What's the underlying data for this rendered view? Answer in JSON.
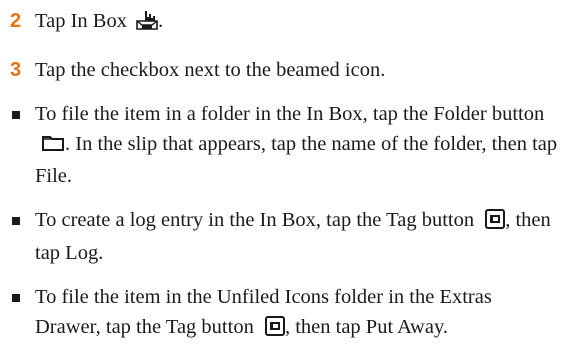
{
  "steps": [
    {
      "number": "2",
      "text_before_icon": "Tap In Box",
      "icon": "in-box-icon",
      "text_after_icon": "."
    },
    {
      "number": "3",
      "text": "Tap the checkbox next to the beamed icon."
    }
  ],
  "bullets": [
    {
      "text_before_icon": "To file the item in a folder in the In Box, tap the Folder button",
      "icon": "folder-icon",
      "text_after_icon": ". In the slip that appears, tap the name of the folder, then tap File."
    },
    {
      "text_before_icon": "To create a log entry in the In Box, tap the Tag button",
      "icon": "tag-icon",
      "text_after_icon": ", then tap Log."
    },
    {
      "text_before_icon": "To file the item in the Unfiled Icons folder in the Extras Drawer, tap the Tag button",
      "icon": "tag-icon",
      "text_after_icon": ", then tap Put Away."
    }
  ],
  "colors": {
    "step_number": "#e8720c",
    "text": "#1a1a1a"
  }
}
